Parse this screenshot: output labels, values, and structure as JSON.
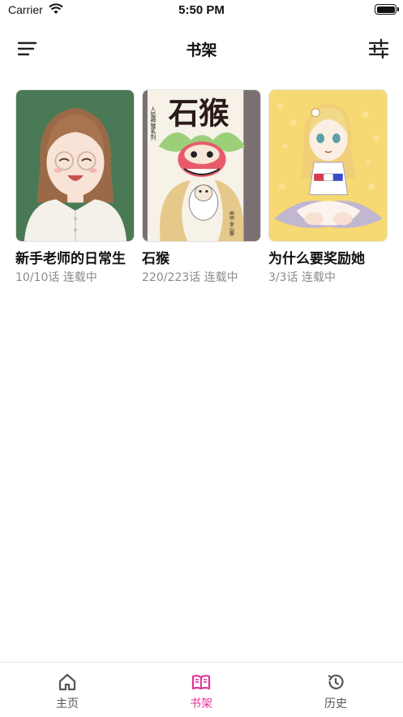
{
  "status_bar": {
    "carrier": "Carrier",
    "time": "5:50 PM"
  },
  "nav": {
    "title": "书架",
    "menu_icon": "menu-icon",
    "filter_icon": "sliders-icon"
  },
  "books": [
    {
      "title": "新手老师的日常生",
      "progress": "10/10话",
      "status": "连载中",
      "cover": "cover-girl-with-glasses"
    },
    {
      "title": "石猴",
      "progress": "220/223话",
      "status": "连载中",
      "cover": "cover-stone-monkey",
      "cover_text": {
        "big_title": "石猴",
        "series": "人猿神猴系列",
        "author": "画师·李山猴"
      }
    },
    {
      "title": "为什么要奖励她",
      "progress": "3/3话",
      "status": "连载中",
      "cover": "cover-anime-girl"
    }
  ],
  "tabs": [
    {
      "label": "主页",
      "icon": "home-icon",
      "active": false
    },
    {
      "label": "书架",
      "icon": "book-open-icon",
      "active": true
    },
    {
      "label": "历史",
      "icon": "history-icon",
      "active": false
    }
  ],
  "colors": {
    "accent": "#e0359a",
    "meta_text": "#8a8a8a",
    "tab_inactive": "#555555"
  }
}
